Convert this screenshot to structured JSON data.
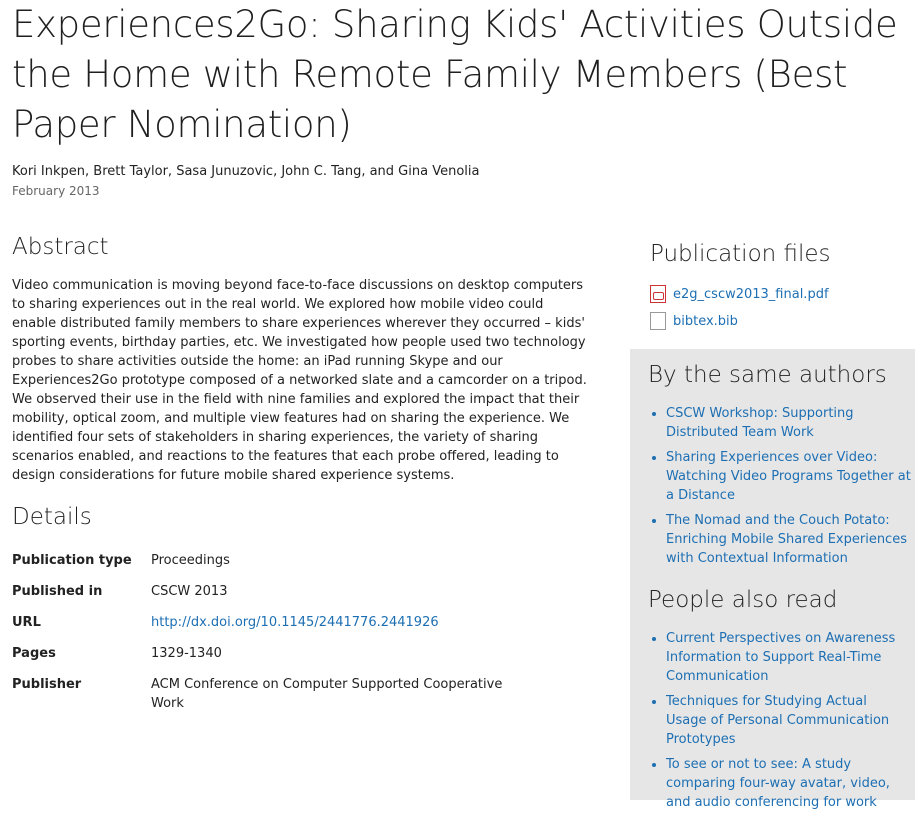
{
  "paper": {
    "title": "Experiences2Go: Sharing Kids' Activities Outside the Home with Remote Family Members (Best Paper Nomination)",
    "authors": "Kori Inkpen, Brett Taylor, Sasa Junuzovic, John C. Tang, and Gina Venolia",
    "date": "February 2013"
  },
  "abstract": {
    "heading": "Abstract",
    "text": "Video communication is moving beyond face-to-face discussions on desktop computers to sharing experiences out in the real world. We explored how mobile video could enable distributed family members to share experiences wherever they occurred – kids' sporting events, birthday parties, etc. We investigated how people used two technology probes to share activities outside the home: an iPad running Skype and our Experiences2Go prototype composed of a networked slate and a camcorder on a tripod. We observed their use in the field with nine families and explored the impact that their mobility, optical zoom, and multiple view features had on sharing the experience. We identified four sets of stakeholders in sharing experiences, the variety of sharing scenarios enabled, and reactions to the features that each probe offered, leading to design considerations for future mobile shared experience systems."
  },
  "details": {
    "heading": "Details",
    "rows": [
      {
        "key": "Publication type",
        "value": "Proceedings"
      },
      {
        "key": "Published in",
        "value": "CSCW 2013"
      },
      {
        "key": "URL",
        "value": "http://dx.doi.org/10.1145/2441776.2441926"
      },
      {
        "key": "Pages",
        "value": "1329-1340"
      },
      {
        "key": "Publisher",
        "value": "ACM Conference on Computer Supported Cooperative Work"
      }
    ]
  },
  "files": {
    "heading": "Publication files",
    "items": [
      {
        "label": "e2g_cscw2013_final.pdf",
        "icon": "pdf-file-icon"
      },
      {
        "label": "bibtex.bib",
        "icon": "document-icon"
      }
    ]
  },
  "same_authors": {
    "heading": "By the same authors",
    "items": [
      "CSCW Workshop: Supporting Distributed Team Work",
      "Sharing Experiences over Video: Watching Video Programs Together at a Distance",
      "The Nomad and the Couch Potato: Enriching Mobile Shared Experiences with Contextual Information"
    ]
  },
  "also_read": {
    "heading": "People also read",
    "items": [
      "Current Perspectives on Awareness Information to Support Real-Time Communication",
      "Techniques for Studying Actual Usage of Personal Communication Prototypes",
      "To see or not to see: A study comparing four-way avatar, video, and audio conferencing for work"
    ]
  },
  "colors": {
    "link": "#1d6fb3",
    "sidebar_bg": "#e6e6e6"
  }
}
